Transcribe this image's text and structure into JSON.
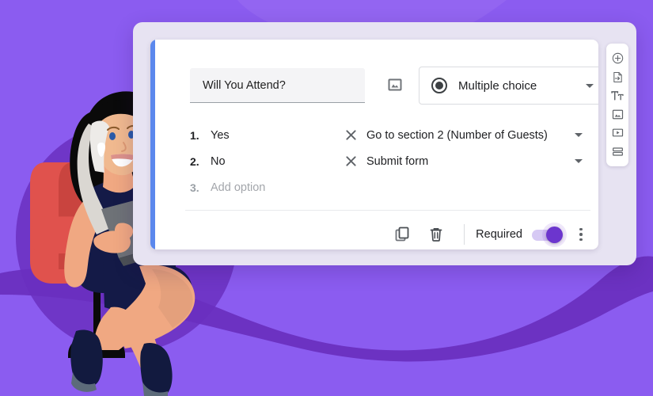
{
  "theme": {
    "background_purple": "#8B5CF0",
    "background_purple_dark": "#6A2FBF",
    "panel_lavender": "#E7E3F2",
    "card_white": "#FFFFFF",
    "accent_blue": "#5B88ED",
    "toggle_on_purple": "#6C35CE",
    "toggle_track_lavender": "#D6C9F4",
    "text_primary": "#202124",
    "text_muted": "#A3A6AB",
    "icon_gray": "#5F6368",
    "divider_gray": "#E8EAED"
  },
  "illustration": {
    "name": "woman-sitting-in-chair-with-laptop",
    "skin": "#F0A882",
    "skin_shade": "#E09A77",
    "hair": "#0A0A0A",
    "hair_highlight": "#D8D5D0",
    "dress": "#141A47",
    "chair": "#E0524D",
    "chair_shade": "#C0413D",
    "laptop": "#6E7277",
    "laptop_dark": "#4C5155",
    "shoes": "#121A3F"
  },
  "question_card": {
    "title_value": "Will You Attend?",
    "title_placeholder": "Question",
    "image_button_name": "insert-image",
    "type_select": {
      "value": "Multiple choice",
      "icon": "radio-button-icon"
    },
    "options": [
      {
        "number": "1.",
        "label": "Yes",
        "is_placeholder": false,
        "go_to": "Go to section 2 (Number of Guests)",
        "has_go_to": true
      },
      {
        "number": "2.",
        "label": "No",
        "is_placeholder": false,
        "go_to": "Submit form",
        "has_go_to": true
      },
      {
        "number": "3.",
        "label": "Add option",
        "is_placeholder": true,
        "go_to": "",
        "has_go_to": false
      }
    ],
    "footer": {
      "duplicate_label": "Duplicate",
      "delete_label": "Delete",
      "required_label": "Required",
      "required_on": true,
      "more_label": "More options"
    }
  },
  "toolbar": {
    "items": [
      {
        "icon": "add-circle-icon",
        "label": "Add question"
      },
      {
        "icon": "import-questions-icon",
        "label": "Import questions"
      },
      {
        "icon": "title-and-description-icon",
        "label": "Add title and description"
      },
      {
        "icon": "add-image-icon",
        "label": "Add image"
      },
      {
        "icon": "add-video-icon",
        "label": "Add video"
      },
      {
        "icon": "add-section-icon",
        "label": "Add section"
      }
    ]
  }
}
